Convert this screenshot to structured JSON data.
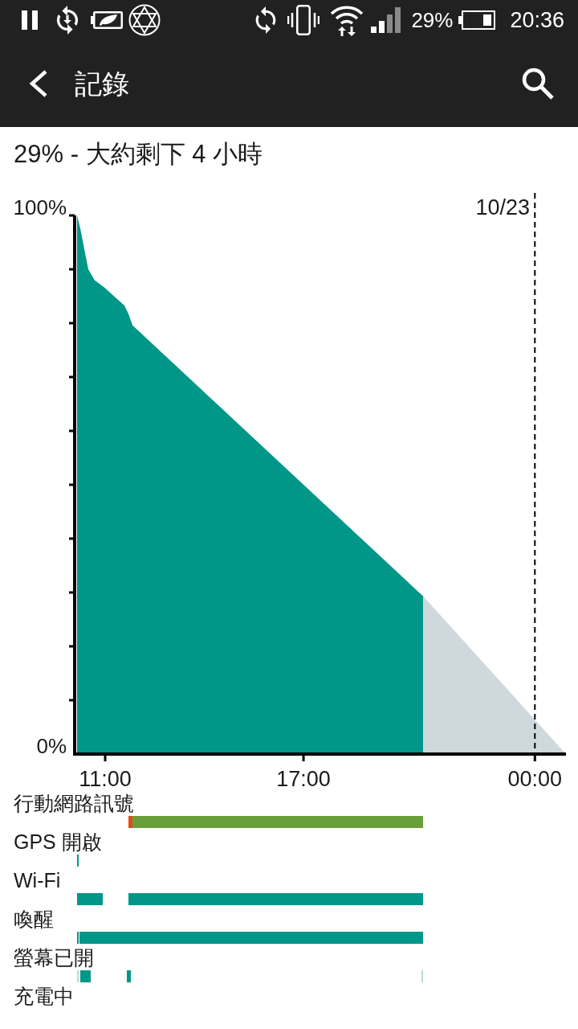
{
  "status_bar": {
    "battery_percent": "29%",
    "time": "20:36"
  },
  "app_bar": {
    "title": "記錄"
  },
  "summary": "29% - 大約剩下 4 小時",
  "battery_chart": {
    "date_label": "10/23",
    "chart_data": {
      "type": "area",
      "x": [
        10.15,
        10.25,
        10.37,
        10.49,
        10.68,
        10.98,
        11.58,
        11.7,
        11.83,
        20.62,
        24.94
      ],
      "series": [
        {
          "color": "#009688",
          "values": [
            100,
            97.5,
            93.7,
            90,
            88,
            86.6,
            83.3,
            81.8,
            79.6,
            29.3,
            null
          ]
        },
        {
          "color": "#cfd8dc",
          "values": [
            null,
            null,
            null,
            null,
            null,
            null,
            null,
            null,
            null,
            29.3,
            0
          ]
        }
      ],
      "xlim": [
        10.15,
        24.94
      ],
      "ylim": [
        0,
        100
      ],
      "xticks": [
        {
          "value": 11,
          "label": "11:00"
        },
        {
          "value": 17,
          "label": "17:00"
        },
        {
          "value": 24,
          "label": "00:00"
        }
      ],
      "yticks": [
        {
          "value": 0,
          "label": "0%"
        },
        {
          "value": 100,
          "label": "100%"
        }
      ],
      "ref_lines": [
        {
          "axis": "x",
          "value": 24
        }
      ]
    }
  },
  "timelines": [
    {
      "label": "行動網路訊號"
    },
    {
      "label": "GPS 開啟"
    },
    {
      "label": "Wi-Fi"
    },
    {
      "label": "喚醒"
    },
    {
      "label": "螢幕已開"
    },
    {
      "label": "充電中"
    }
  ]
}
